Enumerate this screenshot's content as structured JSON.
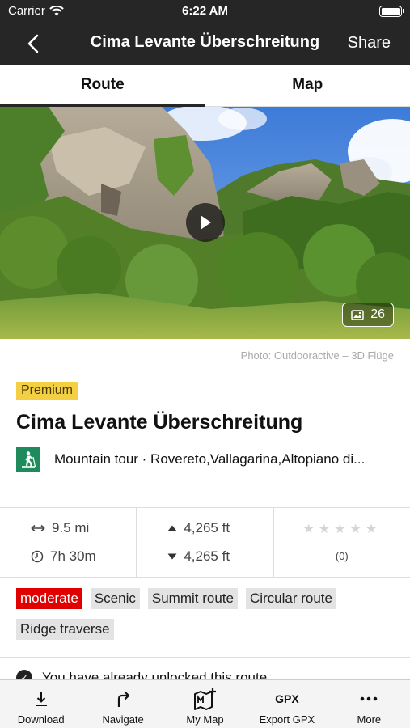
{
  "status_bar": {
    "carrier": "Carrier",
    "time": "6:22 AM"
  },
  "nav": {
    "title": "Cima Levante Überschreitung",
    "share_label": "Share"
  },
  "tabs": [
    {
      "label": "Route",
      "active": true
    },
    {
      "label": "Map",
      "active": false
    }
  ],
  "hero": {
    "photo_count": "26"
  },
  "photo_credit": "Photo: Outdooractive – 3D Flüge",
  "premium_badge": "Premium",
  "route": {
    "title": "Cima Levante Überschreitung",
    "type_text": "Mountain tour · Rovereto,Vallagarina,Altopiano di..."
  },
  "stats": {
    "distance": "9.5 mi",
    "duration": "7h 30m",
    "ascent": "4,265 ft",
    "descent": "4,265 ft",
    "rating_stars": "★★★★★",
    "rating_count": "(0)"
  },
  "tags": [
    "moderate",
    "Scenic",
    "Summit route",
    "Circular route",
    "Ridge traverse"
  ],
  "unlocked_text": "You have already unlocked this route",
  "toolbar": [
    {
      "label": "Download",
      "icon": "download-icon"
    },
    {
      "label": "Navigate",
      "icon": "navigate-icon"
    },
    {
      "label": "My Map",
      "icon": "my-map-icon"
    },
    {
      "label": "Export GPX",
      "icon": "gpx-icon",
      "icon_text": "GPX"
    },
    {
      "label": "More",
      "icon": "more-icon"
    }
  ],
  "colors": {
    "nav_bg": "#262626",
    "premium": "#f3cf43",
    "moderate": "#e00000",
    "tour_icon": "#1f8a5c"
  }
}
